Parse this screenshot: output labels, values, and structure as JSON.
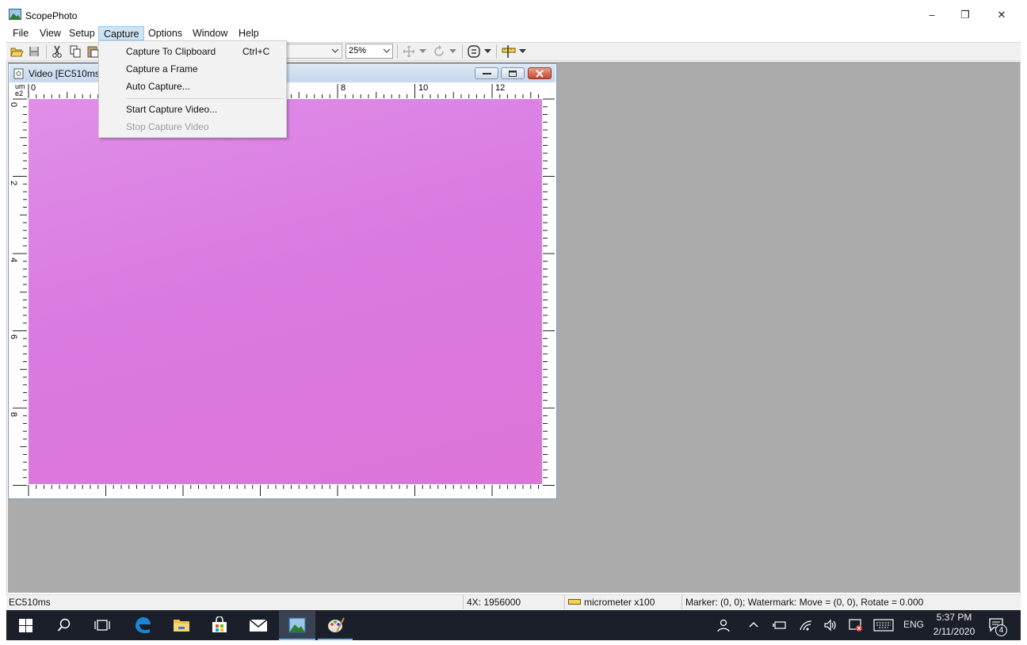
{
  "app": {
    "title": "ScopePhoto"
  },
  "window_controls": {
    "minimize": "–",
    "restore": "❐",
    "close": "✕"
  },
  "menu": [
    "File",
    "View",
    "Setup",
    "Capture",
    "Options",
    "Window",
    "Help"
  ],
  "toolbar": {
    "zoom_value": "25%"
  },
  "video_window": {
    "title": "Video [EC510ms]",
    "ruler_unit_top": "um",
    "ruler_unit_bottom": "e2",
    "top_ticks": [
      "0",
      "8",
      "10",
      "12"
    ],
    "left_ticks": [
      "0",
      "2",
      "4",
      "6",
      "8"
    ]
  },
  "capture_menu": {
    "items": [
      {
        "label": "Capture To Clipboard",
        "shortcut": "Ctrl+C",
        "enabled": true
      },
      {
        "label": "Capture a Frame",
        "shortcut": "",
        "enabled": true
      },
      {
        "label": "Auto Capture...",
        "shortcut": "",
        "enabled": true
      },
      {
        "label": "Start Capture Video...",
        "shortcut": "",
        "enabled": true
      },
      {
        "label": "Stop Capture Video",
        "shortcut": "",
        "enabled": false
      }
    ]
  },
  "status_bar": {
    "left": "EC510ms",
    "magnification": "4X: 1956000",
    "unit": "micrometer x100",
    "marker": "Marker: (0, 0); Watermark: Move = (0, 0), Rotate = 0.000"
  },
  "taskbar": {
    "language": "ENG",
    "time": "5:37 PM",
    "date": "2/11/2020",
    "notifications_count": "4"
  },
  "colors": {
    "mdi_background": "#ababab",
    "image_color": "#dc80e0",
    "taskbar": "#1b1f29",
    "menu_highlight": "#cce4f7"
  }
}
